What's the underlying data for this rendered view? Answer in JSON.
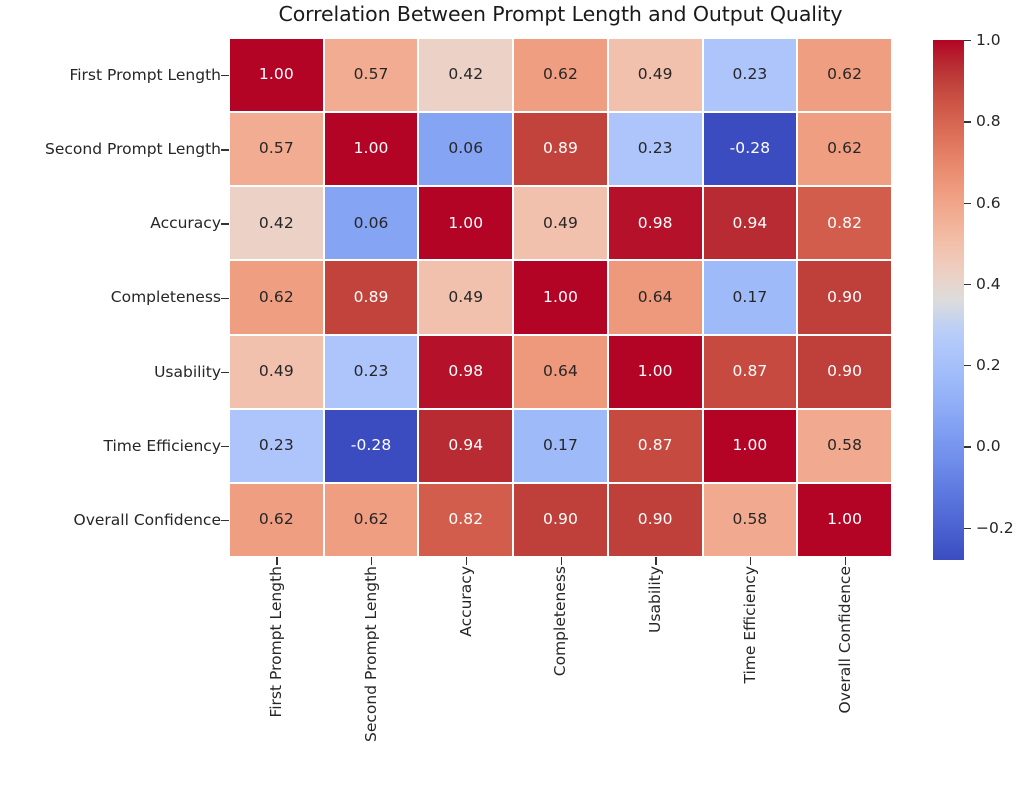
{
  "chart_data": {
    "type": "heatmap",
    "title": "Correlation Between Prompt Length and Output Quality",
    "xlabel": "",
    "ylabel": "",
    "grid": false,
    "annotated": true,
    "value_format": "2 decimals",
    "categories": [
      "First Prompt Length",
      "Second Prompt Length",
      "Accuracy",
      "Completeness",
      "Usability",
      "Time Efficiency",
      "Overall Confidence"
    ],
    "x_tick_labels": [
      "First Prompt Length",
      "Second Prompt Length",
      "Accuracy",
      "Completeness",
      "Usability",
      "Time Efficiency",
      "Overall Confidence"
    ],
    "y_tick_labels": [
      "First Prompt Length",
      "Second Prompt Length",
      "Accuracy",
      "Completeness",
      "Usability",
      "Time Efficiency",
      "Overall Confidence"
    ],
    "x_tick_rotation": 90,
    "values": [
      [
        1.0,
        0.57,
        0.42,
        0.62,
        0.49,
        0.23,
        0.62
      ],
      [
        0.57,
        1.0,
        0.06,
        0.89,
        0.23,
        -0.28,
        0.62
      ],
      [
        0.42,
        0.06,
        1.0,
        0.49,
        0.98,
        0.94,
        0.82
      ],
      [
        0.62,
        0.89,
        0.49,
        1.0,
        0.64,
        0.17,
        0.9
      ],
      [
        0.49,
        0.23,
        0.98,
        0.64,
        1.0,
        0.87,
        0.9
      ],
      [
        0.23,
        -0.28,
        0.94,
        0.17,
        0.87,
        1.0,
        0.58
      ],
      [
        0.62,
        0.62,
        0.82,
        0.9,
        0.9,
        0.58,
        1.0
      ]
    ],
    "cell_labels": [
      [
        "1.00",
        "0.57",
        "0.42",
        "0.62",
        "0.49",
        "0.23",
        "0.62"
      ],
      [
        "0.57",
        "1.00",
        "0.06",
        "0.89",
        "0.23",
        "-0.28",
        "0.62"
      ],
      [
        "0.42",
        "0.06",
        "1.00",
        "0.49",
        "0.98",
        "0.94",
        "0.82"
      ],
      [
        "0.62",
        "0.89",
        "0.49",
        "1.00",
        "0.64",
        "0.17",
        "0.90"
      ],
      [
        "0.49",
        "0.23",
        "0.98",
        "0.64",
        "1.00",
        "0.87",
        "0.90"
      ],
      [
        "0.23",
        "-0.28",
        "0.94",
        "0.17",
        "0.87",
        "1.00",
        "0.58"
      ],
      [
        "0.62",
        "0.62",
        "0.82",
        "0.90",
        "0.90",
        "0.58",
        "1.00"
      ]
    ],
    "colormap": "coolwarm",
    "vmin": -0.28,
    "vmax": 1.0,
    "colorbar": {
      "tick_labels": [
        "1.0",
        "0.8",
        "0.6",
        "0.4",
        "0.2",
        "0.0",
        "−0.2"
      ],
      "tick_values": [
        1.0,
        0.8,
        0.6,
        0.4,
        0.2,
        0.0,
        -0.2
      ],
      "orientation": "vertical",
      "position": "right"
    },
    "colors": {
      "low": "#3b4cc0",
      "mid": "#dddcdb",
      "high": "#b40426",
      "text_light": "#ffffff",
      "text_dark": "#262626",
      "background": "#ffffff",
      "tick": "#333333"
    }
  }
}
